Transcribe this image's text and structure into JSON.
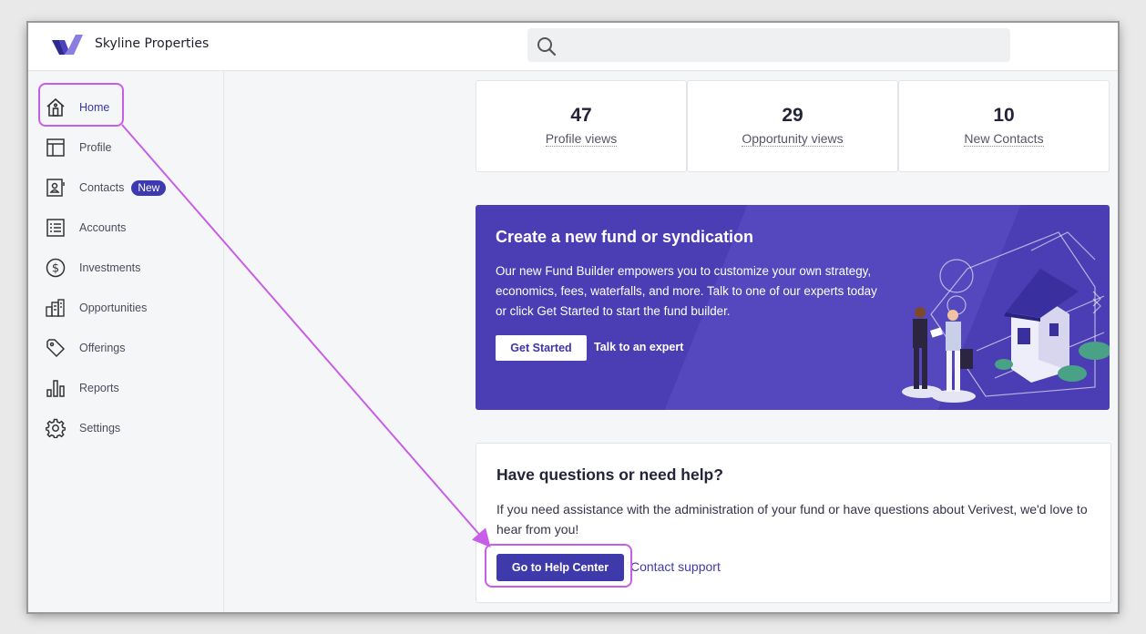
{
  "app": {
    "brand": "Skyline Properties",
    "accent": "#3d39b0",
    "annotation_color": "#c85ee8"
  },
  "search": {
    "placeholder": "",
    "icon": "search-icon"
  },
  "sidebar": {
    "items": [
      {
        "label": "Home",
        "icon": "home-icon",
        "active": true
      },
      {
        "label": "Profile",
        "icon": "profile-layout-icon"
      },
      {
        "label": "Contacts",
        "icon": "contact-card-icon",
        "badge": "New"
      },
      {
        "label": "Accounts",
        "icon": "list-icon"
      },
      {
        "label": "Investments",
        "icon": "dollar-circle-icon"
      },
      {
        "label": "Opportunities",
        "icon": "buildings-icon"
      },
      {
        "label": "Offerings",
        "icon": "tag-icon"
      },
      {
        "label": "Reports",
        "icon": "bar-chart-icon"
      },
      {
        "label": "Settings",
        "icon": "gear-icon"
      }
    ]
  },
  "stats": [
    {
      "value": "47",
      "label": "Profile views"
    },
    {
      "value": "29",
      "label": "Opportunity views"
    },
    {
      "value": "10",
      "label": "New Contacts"
    }
  ],
  "banner": {
    "title": "Create a new fund or syndication",
    "body": "Our new Fund Builder empowers you to customize your own strategy, economics, fees, waterfalls, and more. Talk to one of our experts today or click Get Started to start the fund builder.",
    "primary_label": "Get Started",
    "secondary_label": "Talk to an expert",
    "background": "#4b3db4"
  },
  "help": {
    "title": "Have questions or need help?",
    "body": "If you need assistance with the administration of your fund or have questions about Verivest, we'd love to hear from you!",
    "primary_label": "Go to Help Center",
    "secondary_label": "Contact support"
  }
}
